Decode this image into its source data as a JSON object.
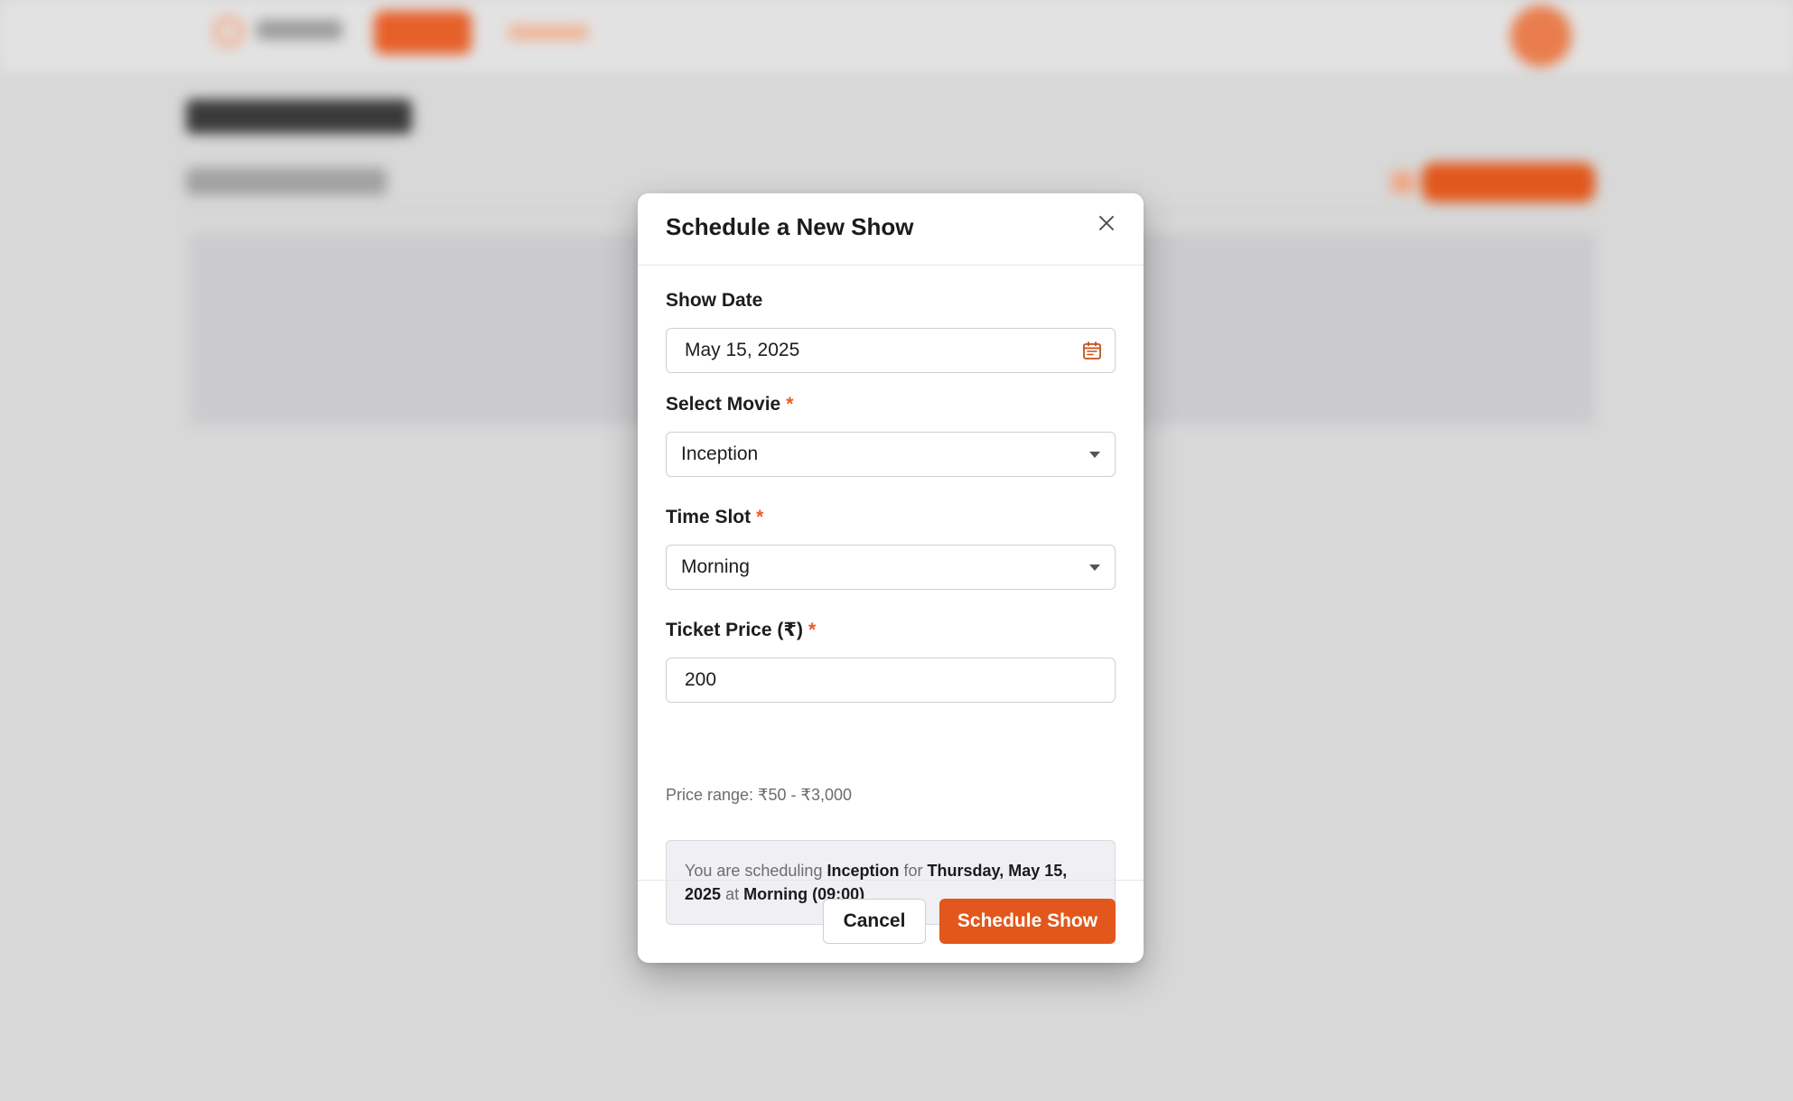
{
  "colors": {
    "accent": "#e2571c",
    "required_star": "#ee5a2a",
    "overlay": "#d8d8d8"
  },
  "modal": {
    "title": "Schedule a New Show",
    "close_icon": "close-icon",
    "fields": {
      "show_date": {
        "label": "Show Date",
        "value": "May 15, 2025",
        "icon": "calendar-icon"
      },
      "movie": {
        "label": "Select Movie",
        "required": "*",
        "value": "Inception",
        "icon": "chevron-down-icon"
      },
      "time_slot": {
        "label": "Time Slot",
        "required": "*",
        "value": "Morning",
        "icon": "chevron-down-icon"
      },
      "ticket_price": {
        "label": "Ticket Price (₹)",
        "required": "*",
        "value": "200",
        "help": "Price range: ₹50 - ₹3,000"
      }
    },
    "summary": {
      "prefix": "You are scheduling",
      "movie": "Inception",
      "for_word": "for",
      "date": "Thursday, May 15, 2025",
      "at_word": "at",
      "slot": "Morning (09:00)"
    },
    "footer": {
      "cancel_label": "Cancel",
      "submit_label": "Schedule Show"
    }
  }
}
